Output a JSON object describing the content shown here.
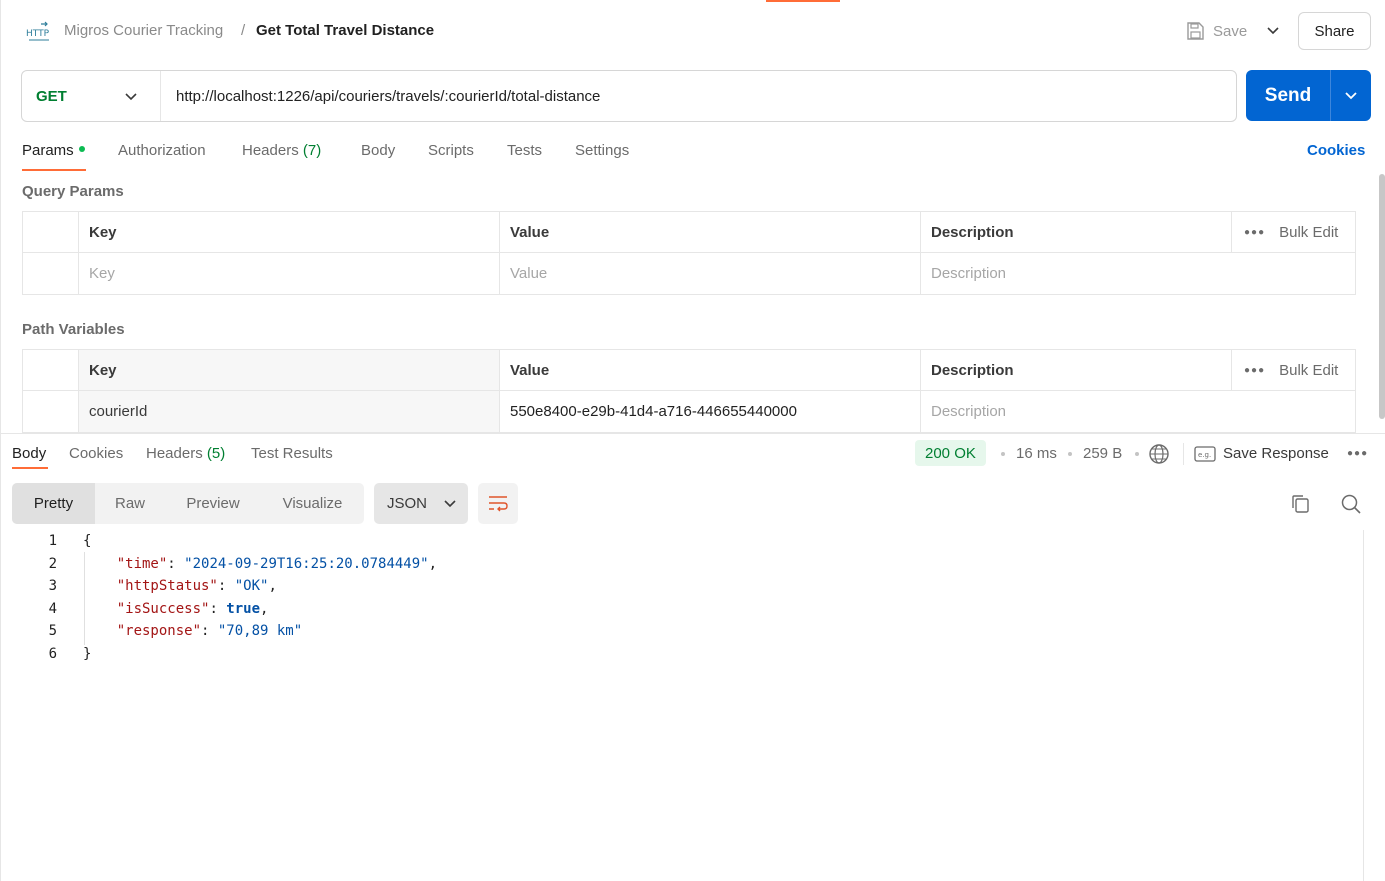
{
  "header": {
    "collection": "Migros Courier Tracking",
    "separator": "/",
    "title": "Get Total Travel Distance",
    "save_label": "Save",
    "share_label": "Share"
  },
  "request": {
    "method": "GET",
    "url": "http://localhost:1226/api/couriers/travels/:courierId/total-distance",
    "send_label": "Send"
  },
  "request_tabs": {
    "params": "Params",
    "authorization": "Authorization",
    "headers": "Headers",
    "headers_count": "(7)",
    "body": "Body",
    "scripts": "Scripts",
    "tests": "Tests",
    "settings": "Settings",
    "cookies": "Cookies"
  },
  "query_params": {
    "title": "Query Params",
    "columns": {
      "key": "Key",
      "value": "Value",
      "description": "Description",
      "bulk_edit": "Bulk Edit"
    },
    "placeholders": {
      "key": "Key",
      "value": "Value",
      "description": "Description"
    }
  },
  "path_variables": {
    "title": "Path Variables",
    "columns": {
      "key": "Key",
      "value": "Value",
      "description": "Description",
      "bulk_edit": "Bulk Edit"
    },
    "rows": [
      {
        "key": "courierId",
        "value": "550e8400-e29b-41d4-a716-446655440000",
        "description_placeholder": "Description"
      }
    ]
  },
  "response_tabs": {
    "body": "Body",
    "cookies": "Cookies",
    "headers": "Headers",
    "headers_count": "(5)",
    "test_results": "Test Results"
  },
  "response_meta": {
    "status": "200 OK",
    "time": "16 ms",
    "size": "259 B",
    "save_response": "Save Response"
  },
  "view_options": {
    "pretty": "Pretty",
    "raw": "Raw",
    "preview": "Preview",
    "visualize": "Visualize",
    "format": "JSON"
  },
  "code": {
    "line_numbers": [
      "1",
      "2",
      "3",
      "4",
      "5",
      "6"
    ],
    "open_brace": "{",
    "close_brace": "}",
    "entries": [
      {
        "key": "\"time\"",
        "value": "\"2024-09-29T16:25:20.0784449\"",
        "trail": ","
      },
      {
        "key": "\"httpStatus\"",
        "value": "\"OK\"",
        "trail": ","
      },
      {
        "key": "\"isSuccess\"",
        "value": "true",
        "trail": ","
      },
      {
        "key": "\"response\"",
        "value": "\"70,89 km\"",
        "trail": ""
      }
    ]
  },
  "colors": {
    "accent": "#ff6c37",
    "primary": "#0265d2",
    "method_get": "#007f31",
    "status_ok_bg": "#e6f7ec"
  }
}
